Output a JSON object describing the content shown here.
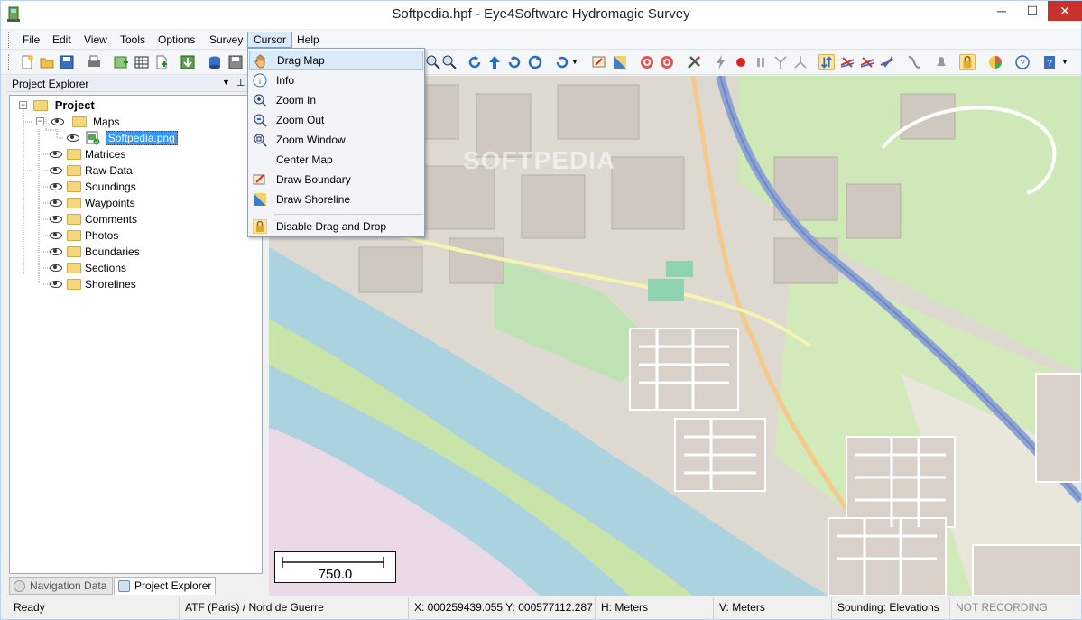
{
  "window": {
    "title": "Softpedia.hpf - Eye4Software Hydromagic Survey",
    "minimize": "─",
    "maximize": "☐",
    "close": "✕"
  },
  "menubar": [
    "File",
    "Edit",
    "View",
    "Tools",
    "Options",
    "Survey",
    "Cursor",
    "Help"
  ],
  "cursor_menu": {
    "items": [
      "Drag Map",
      "Info",
      "Zoom In",
      "Zoom Out",
      "Zoom Window",
      "Center Map",
      "Draw Boundary",
      "Draw Shoreline"
    ],
    "extra": "Disable Drag and Drop"
  },
  "panel": {
    "title": "Project Explorer",
    "tree": {
      "root": "Project",
      "maps": "Maps",
      "map_file": "Softpedia.png",
      "children": [
        "Matrices",
        "Raw Data",
        "Soundings",
        "Waypoints",
        "Comments",
        "Photos",
        "Boundaries",
        "Sections",
        "Shorelines"
      ]
    },
    "tabs": [
      "Navigation Data",
      "Project Explorer"
    ]
  },
  "map": {
    "scale_label": "750.0",
    "watermark": "SOFTPEDIA"
  },
  "status": {
    "ready": "Ready",
    "datum": "ATF (Paris) / Nord de Guerre",
    "coords": "X: 000259439.055  Y: 000577112.287",
    "h_unit": "H: Meters",
    "v_unit": "V: Meters",
    "sounding": "Sounding: Elevations",
    "recording": "NOT RECORDING"
  },
  "colors": {
    "selection": "#3399ff",
    "menu_hover": "#dbeaf9",
    "close_btn": "#c7322b"
  }
}
